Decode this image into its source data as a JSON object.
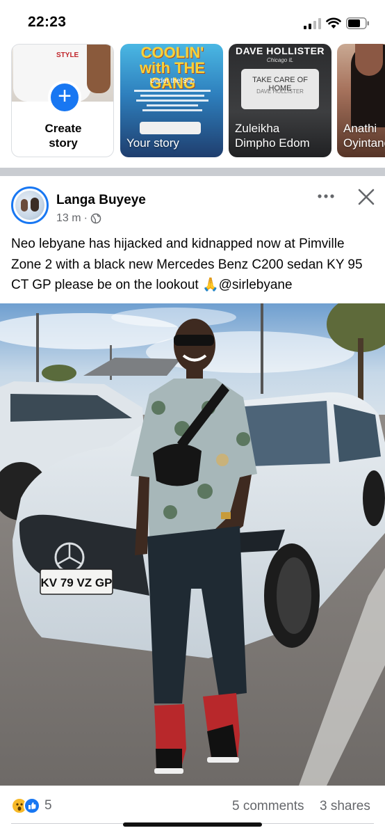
{
  "status_bar": {
    "time": "22:23"
  },
  "stories": [
    {
      "name_line1": "Create",
      "name_line2": "story",
      "type": "create"
    },
    {
      "name": "Your story",
      "poster_title": "COOLIN' with THE GANG",
      "poster_sub": "Under the Sun"
    },
    {
      "name_line1": "Zuleikha",
      "name_line2": "Dimpho Edom",
      "poster_title": "DAVE HOLLISTER",
      "poster_city": "Chicago IL",
      "music_title": "TAKE CARE OF HOME",
      "music_artist": "DAVE HOLLISTER"
    },
    {
      "name_line1": "Anathi",
      "name_line2": "Oyintando"
    }
  ],
  "post": {
    "author": "Langa Buyeye",
    "time": "13 m",
    "text": "Neo lebyane has hijacked and kidnapped now at Pimville Zone 2 with a black new Mercedes Benz C200 sedan KY 95 CT GP please be on the lookout 🙏@sirlebyane",
    "plate": "KV 79 VZ GP"
  },
  "engagement": {
    "reaction_count": "5",
    "comments": "5 comments",
    "shares": "3 shares"
  },
  "icons": {
    "more": "more-dots-icon",
    "close": "close-icon",
    "privacy": "globe-icon",
    "reactions": [
      "wow-icon",
      "like-icon"
    ]
  },
  "colors": {
    "accent": "#1877f2",
    "secondary_text": "#65676b",
    "divider": "#c9ccd1"
  }
}
